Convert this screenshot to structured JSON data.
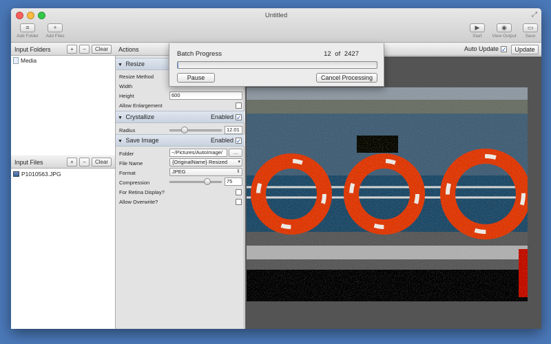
{
  "window": {
    "title": "Untitled"
  },
  "toolbar": {
    "add_folder": "Add Folder",
    "add_files": "Add Files",
    "start": "Start",
    "view_output": "View Output",
    "save": "Save"
  },
  "input_folders": {
    "header": "Input Folders",
    "add": "+",
    "remove": "−",
    "clear": "Clear",
    "items": [
      "Media"
    ]
  },
  "input_files": {
    "header": "Input Files",
    "add": "+",
    "remove": "−",
    "clear": "Clear",
    "items": [
      "P1010563.JPG"
    ]
  },
  "actions": {
    "header": "Actions",
    "resize": {
      "title": "Resize",
      "method_label": "Resize Method",
      "width_label": "Width",
      "height_label": "Height",
      "height_value": "600",
      "allow_enlargement_label": "Allow Enlargement",
      "allow_enlargement": false
    },
    "crystallize": {
      "title": "Crystallize",
      "enabled_label": "Enabled",
      "enabled": true,
      "radius_label": "Radius",
      "radius_value": "12.01",
      "radius_slider": 0.25
    },
    "save_image": {
      "title": "Save Image",
      "enabled_label": "Enabled",
      "enabled": true,
      "folder_label": "Folder",
      "folder_value": "~/Pictures/AutoImage/",
      "folder_browse": "...",
      "file_name_label": "File Name",
      "file_name_value": "{OriginalName} Resized",
      "format_label": "Format",
      "format_value": "JPEG",
      "compression_label": "Compression",
      "compression_value": "75",
      "compression_slider": 0.75,
      "retina_label": "For Retina Display?",
      "retina": false,
      "overwrite_label": "Allow Overwrite?",
      "overwrite": false
    }
  },
  "preview": {
    "auto_update_label": "Auto Update",
    "auto_update": true,
    "update_button": "Update"
  },
  "batch": {
    "title": "Batch Progress",
    "current": "12",
    "of": "of",
    "total": "2427",
    "progress": 0.005,
    "pause": "Pause",
    "cancel": "Cancel Processing"
  },
  "icons": {
    "check": "✓",
    "triangle": "▼",
    "popup_arrow": "▾",
    "popup_updown": "⇕"
  }
}
